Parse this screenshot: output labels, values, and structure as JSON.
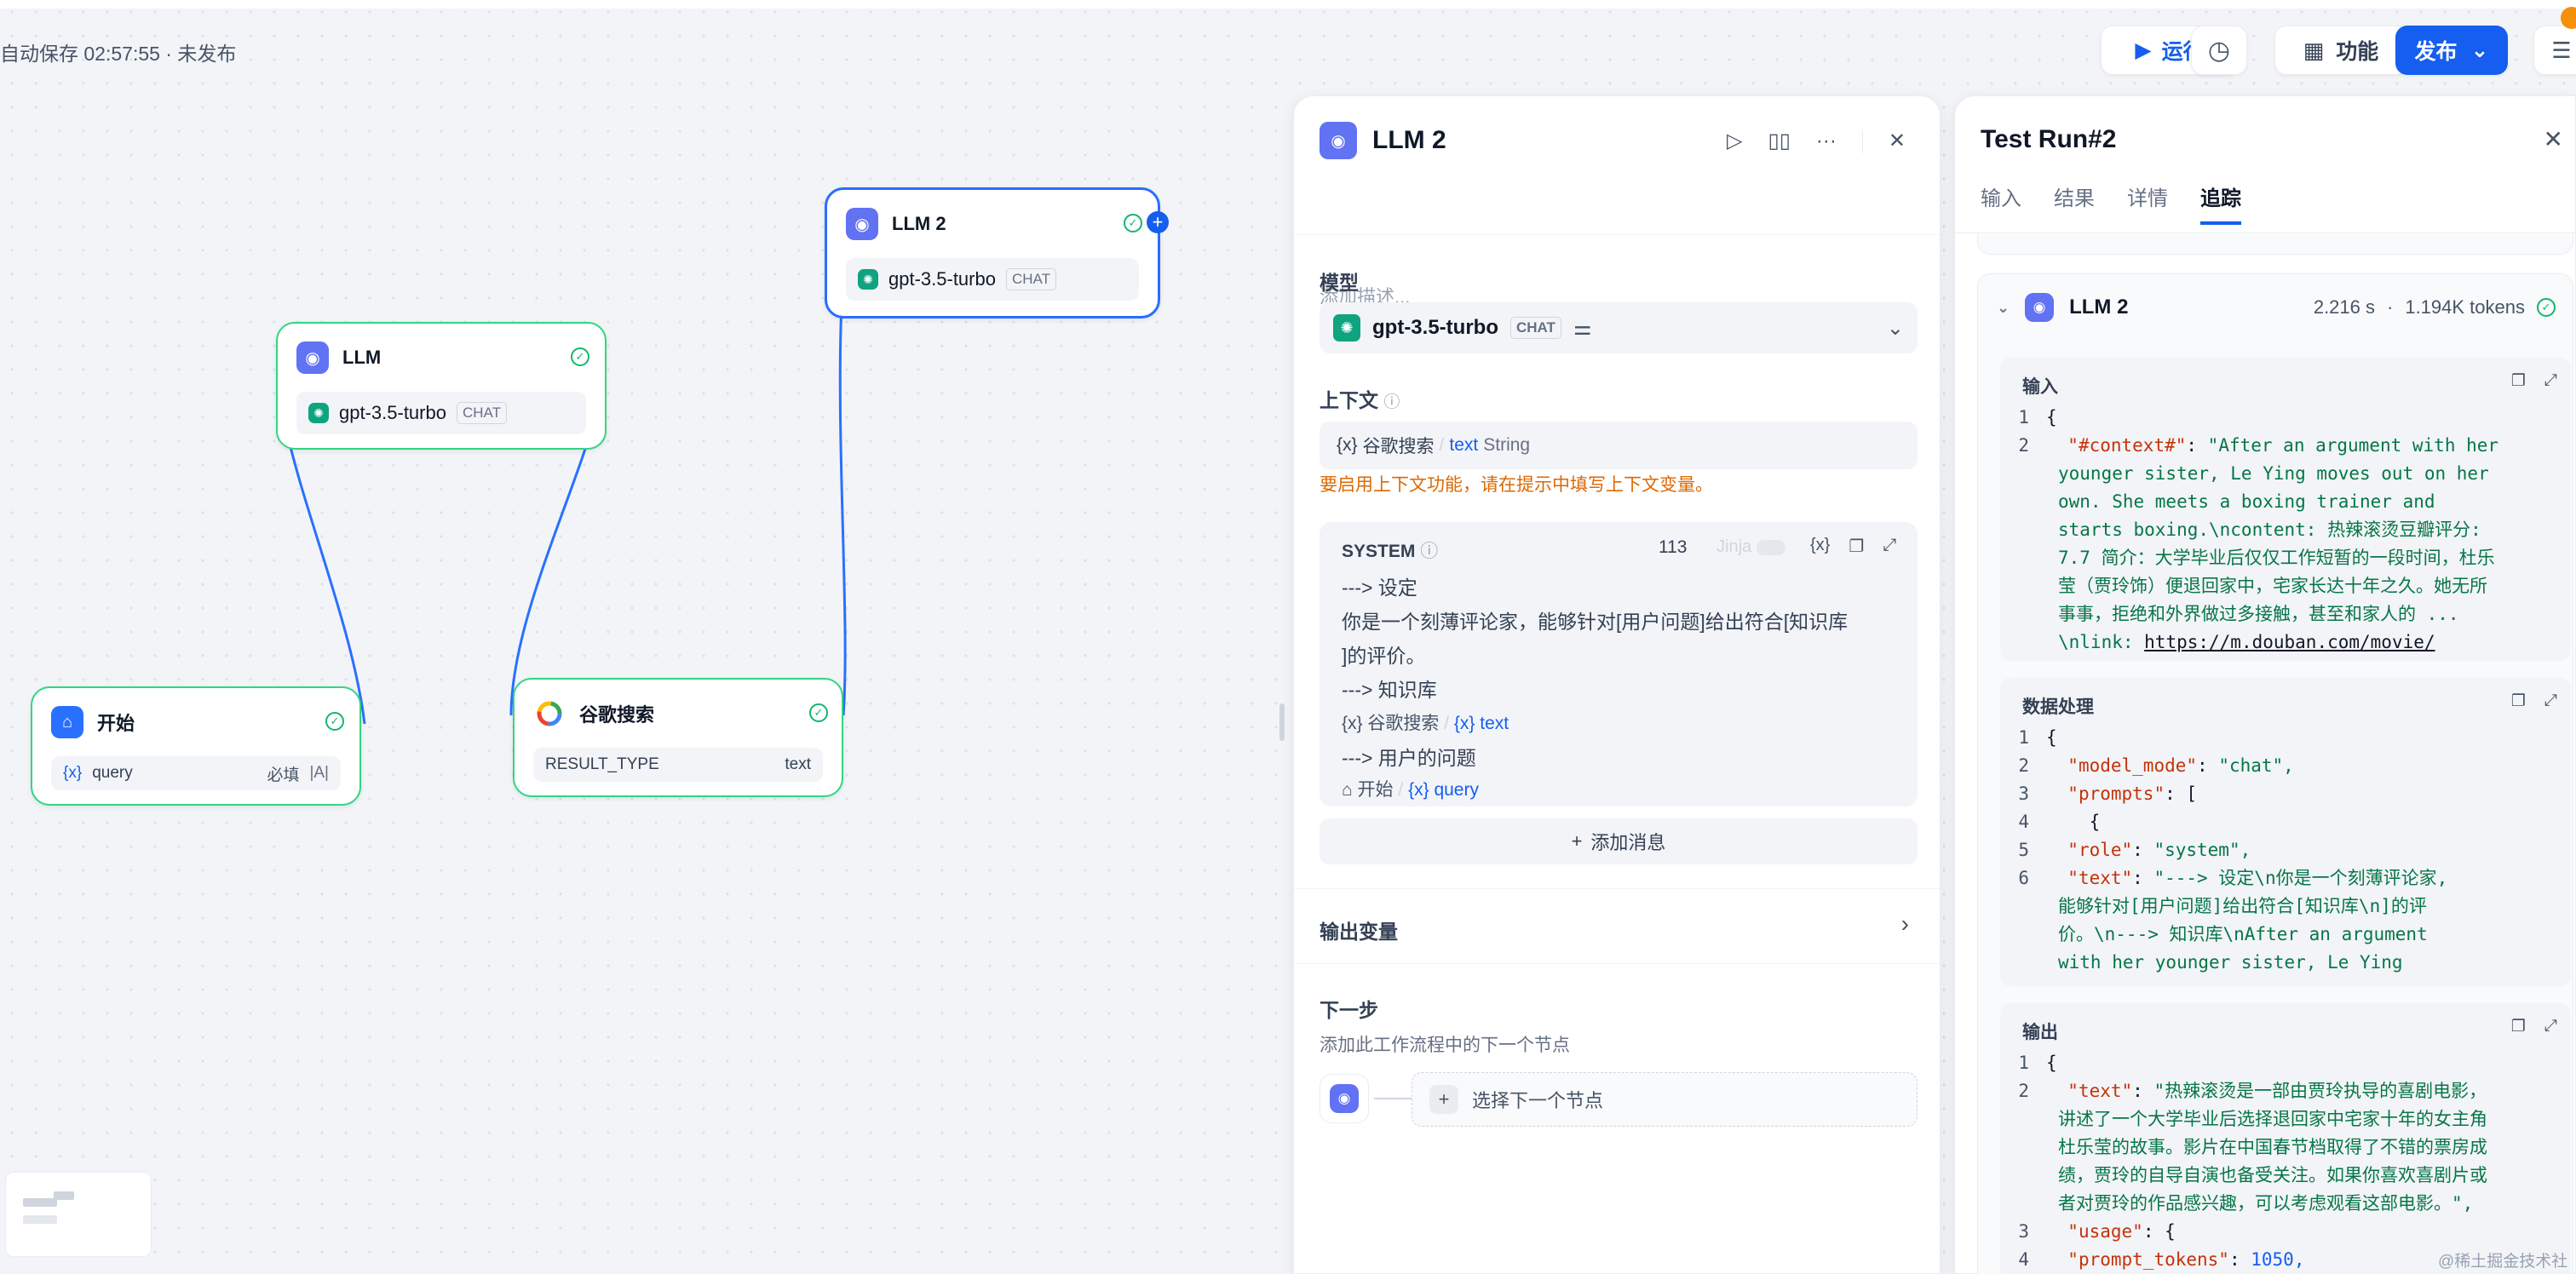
{
  "header": {
    "autosave": "自动保存 02:57:55 · 未发布",
    "run_label": "运行",
    "features_label": "功能",
    "publish_label": "发布"
  },
  "nodes": {
    "llm": {
      "title": "LLM",
      "model": "gpt-3.5-turbo",
      "mode": "CHAT"
    },
    "llm2": {
      "title": "LLM 2",
      "model": "gpt-3.5-turbo",
      "mode": "CHAT"
    },
    "start": {
      "title": "开始",
      "var": "query",
      "required": "必填"
    },
    "google": {
      "title": "谷歌搜索",
      "param": "RESULT_TYPE",
      "param_value": "text"
    }
  },
  "panel": {
    "title": "LLM 2",
    "desc_placeholder": "添加描述...",
    "model_label": "模型",
    "model_name": "gpt-3.5-turbo",
    "model_mode": "CHAT",
    "context_label": "上下文",
    "context_node": "谷歌搜索",
    "context_var": "text",
    "context_type": "String",
    "context_warning": "要启用上下文功能，请在提示中填写上下文变量。",
    "system_label": "SYSTEM",
    "token_count": "113",
    "jinja_label": "Jinja",
    "prompt_line1": "---> 设定",
    "prompt_line2": "你是一个刻薄评论家，能够针对[用户问题]给出符合[知识库",
    "prompt_line3": "]的评价。",
    "prompt_line4": "---> 知识库",
    "var1_node": "谷歌搜索",
    "var1_name": "text",
    "prompt_line5": "---> 用户的问题",
    "var2_node": "开始",
    "var2_name": "query",
    "add_message": "添加消息",
    "output_vars": "输出变量",
    "next_step": "下一步",
    "next_desc": "添加此工作流程中的下一个节点",
    "next_select": "选择下一个节点"
  },
  "run": {
    "title": "Test Run#2",
    "tabs": [
      "输入",
      "结果",
      "详情",
      "追踪"
    ],
    "active_tab": "追踪",
    "node_name": "LLM 2",
    "node_time": "2.216 s",
    "node_tokens": "1.194K tokens",
    "input_label": "输入",
    "input_lines": [
      {
        "n": "1",
        "t": "{"
      },
      {
        "n": "2",
        "k": "\"#context#\"",
        "s": "\"After an argument with her"
      },
      {
        "n": "",
        "s": "younger sister, Le Ying moves out on her"
      },
      {
        "n": "",
        "s": "own. She meets a boxing trainer and"
      },
      {
        "n": "",
        "s": "starts boxing.\\ncontent: 热辣滚烫豆瓣评分:"
      },
      {
        "n": "",
        "s": "7.7 简介：大学毕业后仅仅工作短暂的一段时间，杜乐"
      },
      {
        "n": "",
        "s": "莹（贾玲饰）便退回家中，宅家长达十年之久。她无所"
      },
      {
        "n": "",
        "s": "事事，拒绝和外界做过多接触，甚至和家人的 ..."
      },
      {
        "n": "",
        "s": "\\nlink: ",
        "u": "https://m.douban.com/movie/"
      }
    ],
    "process_label": "数据处理",
    "process_lines": [
      {
        "n": "1",
        "t": "{"
      },
      {
        "n": "2",
        "k": "\"model_mode\"",
        "s": "\"chat\","
      },
      {
        "n": "3",
        "k": "\"prompts\"",
        "t": "["
      },
      {
        "n": "4",
        "t": "  {"
      },
      {
        "n": "5",
        "k": "\"role\"",
        "s": "\"system\","
      },
      {
        "n": "6",
        "k": "\"text\"",
        "s": "\"---> 设定\\n你是一个刻薄评论家,"
      },
      {
        "n": "",
        "s": "能够针对[用户问题]给出符合[知识库\\n]的评"
      },
      {
        "n": "",
        "s": "价。\\n---> 知识库\\nAfter an argument"
      },
      {
        "n": "",
        "s": "with her younger sister, Le Ying"
      }
    ],
    "output_label": "输出",
    "output_lines": [
      {
        "n": "1",
        "t": "{"
      },
      {
        "n": "2",
        "k": "\"text\"",
        "s": "\"热辣滚烫是一部由贾玲执导的喜剧电影，"
      },
      {
        "n": "",
        "s": "讲述了一个大学毕业后选择退回家中宅家十年的女主角"
      },
      {
        "n": "",
        "s": "杜乐莹的故事。影片在中国春节档取得了不错的票房成"
      },
      {
        "n": "",
        "s": "绩，贾玲的自导自演也备受关注。如果你喜欢喜剧片或"
      },
      {
        "n": "",
        "s": "者对贾玲的作品感兴趣，可以考虑观看这部电影。\","
      },
      {
        "n": "3",
        "k": "\"usage\"",
        "t": "{"
      },
      {
        "n": "4",
        "k": "\"prompt_tokens\"",
        "num": "1050,"
      }
    ]
  },
  "watermark": "@稀土掘金技术社区",
  "colors": {
    "accent": "#155eef",
    "success": "#12b76a",
    "warning": "#dc6803",
    "node_border": "#32d583"
  }
}
